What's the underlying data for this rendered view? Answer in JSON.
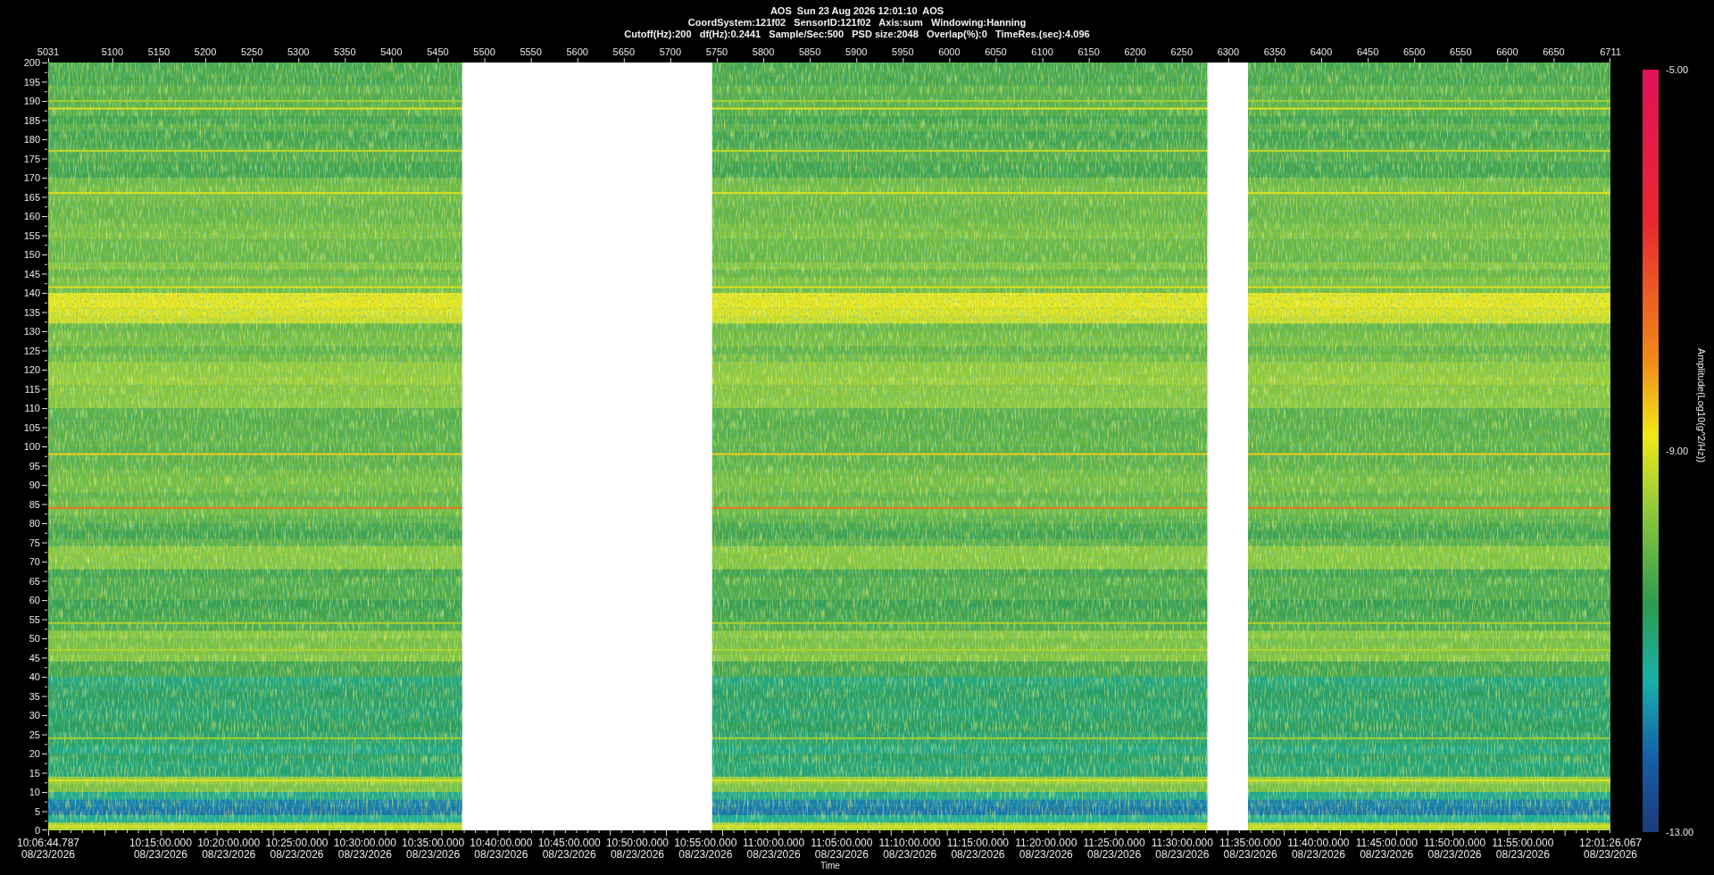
{
  "header": {
    "lines": [
      "AOS  Sun 23 Aug 2026 12:01:10  AOS",
      "CoordSystem:121f02   SensorID:121f02   Axis:sum   Windowing:Hanning",
      "Cutoff(Hz):200   df(Hz):0.2441   Sample/Sec:500   PSD size:2048   Overlap(%):0   TimeRes.(sec):4.096"
    ]
  },
  "top_axis": {
    "labels": [
      "5031",
      "5100",
      "5150",
      "5200",
      "5250",
      "5300",
      "5350",
      "5400",
      "5450",
      "5500",
      "5550",
      "5600",
      "5650",
      "5700",
      "5750",
      "5800",
      "5850",
      "5900",
      "5950",
      "6000",
      "6050",
      "6100",
      "6150",
      "6200",
      "6250",
      "6300",
      "6350",
      "6400",
      "6450",
      "6500",
      "6550",
      "6600",
      "6650",
      "6711"
    ]
  },
  "y_axis": {
    "labels": [
      "200",
      "195",
      "190",
      "185",
      "180",
      "175",
      "170",
      "165",
      "160",
      "155",
      "150",
      "145",
      "140",
      "135",
      "130",
      "125",
      "120",
      "115",
      "110",
      "105",
      "100",
      "95",
      "90",
      "85",
      "80",
      "75",
      "70",
      "65",
      "60",
      "55",
      "50",
      "45",
      "40",
      "35",
      "30",
      "25",
      "20",
      "15",
      "10",
      "5",
      "0"
    ]
  },
  "time_axis": {
    "xlabel": "Time",
    "labels": [
      {
        "time": "10:06:44.787",
        "date": "08/23/2026"
      },
      {
        "time": "10:15:00.000",
        "date": "08/23/2026"
      },
      {
        "time": "10:20:00.000",
        "date": "08/23/2026"
      },
      {
        "time": "10:25:00.000",
        "date": "08/23/2026"
      },
      {
        "time": "10:30:00.000",
        "date": "08/23/2026"
      },
      {
        "time": "10:35:00.000",
        "date": "08/23/2026"
      },
      {
        "time": "10:40:00.000",
        "date": "08/23/2026"
      },
      {
        "time": "10:45:00.000",
        "date": "08/23/2026"
      },
      {
        "time": "10:50:00.000",
        "date": "08/23/2026"
      },
      {
        "time": "10:55:00.000",
        "date": "08/23/2026"
      },
      {
        "time": "11:00:00.000",
        "date": "08/23/2026"
      },
      {
        "time": "11:05:00.000",
        "date": "08/23/2026"
      },
      {
        "time": "11:10:00.000",
        "date": "08/23/2026"
      },
      {
        "time": "11:15:00.000",
        "date": "08/23/2026"
      },
      {
        "time": "11:20:00.000",
        "date": "08/23/2026"
      },
      {
        "time": "11:25:00.000",
        "date": "08/23/2026"
      },
      {
        "time": "11:30:00.000",
        "date": "08/23/2026"
      },
      {
        "time": "11:35:00.000",
        "date": "08/23/2026"
      },
      {
        "time": "11:40:00.000",
        "date": "08/23/2026"
      },
      {
        "time": "11:45:00.000",
        "date": "08/23/2026"
      },
      {
        "time": "11:50:00.000",
        "date": "08/23/2026"
      },
      {
        "time": "11:55:00.000",
        "date": "08/23/2026"
      },
      {
        "time": "12:01:26.067",
        "date": "08/23/2026"
      }
    ]
  },
  "colorbar": {
    "title": "Amplitude(Log10(g^2/Hz))",
    "ticks": [
      "-5.00",
      "-9.00",
      "-13.00"
    ]
  }
}
